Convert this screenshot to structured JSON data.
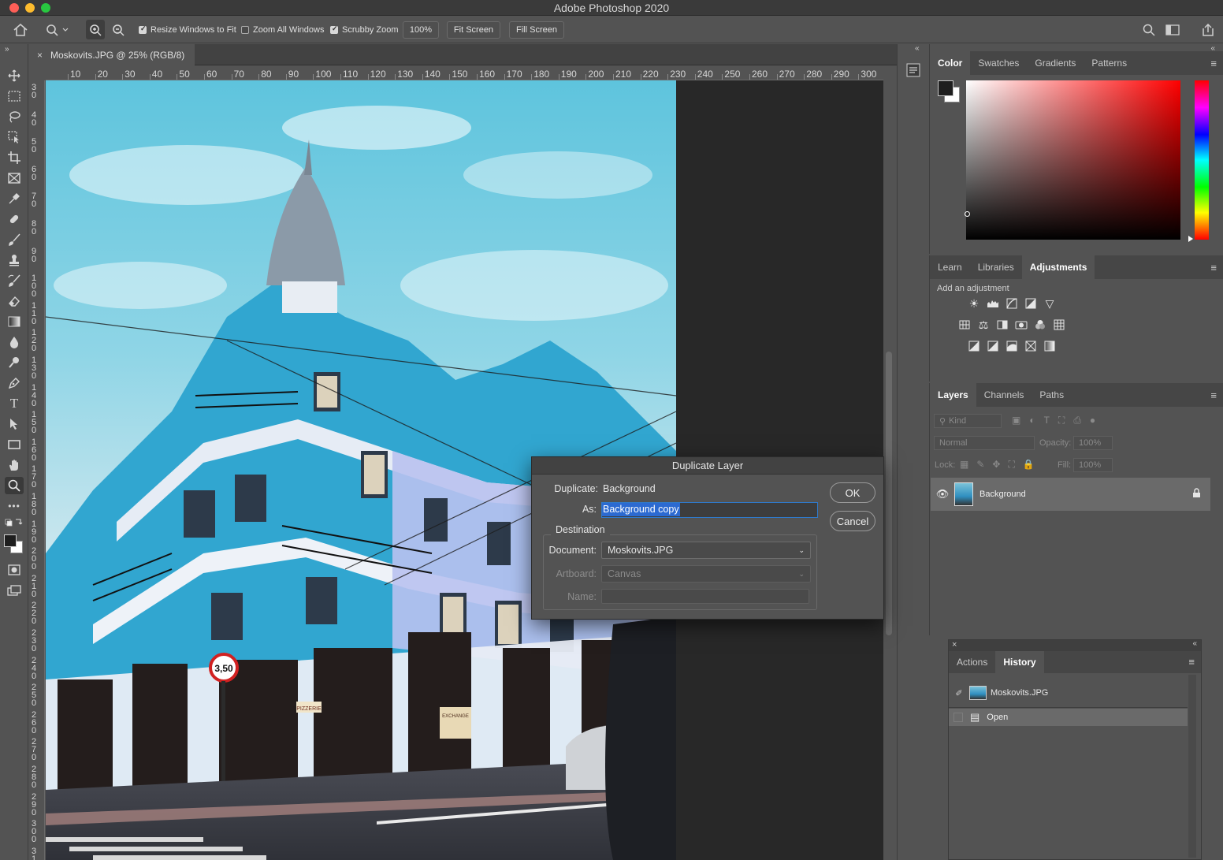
{
  "app": {
    "title": "Adobe Photoshop 2020"
  },
  "options": {
    "resize_windows": "Resize Windows to Fit",
    "zoom_all": "Zoom All Windows",
    "scrubby_zoom": "Scrubby Zoom",
    "zoom_value": "100%",
    "fit_screen": "Fit Screen",
    "fill_screen": "Fill Screen"
  },
  "document": {
    "tab_title": "Moskovits.JPG @ 25% (RGB/8)"
  },
  "ruler": {
    "top": [
      "10",
      "20",
      "30",
      "40",
      "50",
      "60",
      "70",
      "80",
      "90",
      "100",
      "110",
      "120",
      "130",
      "140",
      "150",
      "160",
      "170",
      "180",
      "190",
      "200",
      "210",
      "220",
      "230",
      "240",
      "250",
      "260",
      "270",
      "280",
      "290",
      "300"
    ],
    "left": [
      "3 0",
      "4 0",
      "5 0",
      "6 0",
      "7 0",
      "8 0",
      "9 0",
      "1 0 0",
      "1 1 0",
      "1 2 0",
      "1 3 0",
      "1 4 0",
      "1 5 0",
      "1 6 0",
      "1 7 0",
      "1 8 0",
      "1 9 0",
      "2 0 0",
      "2 1 0",
      "2 2 0",
      "2 3 0",
      "2 4 0",
      "2 5 0",
      "2 6 0",
      "2 7 0",
      "2 8 0",
      "2 9 0",
      "3 0 0",
      "3 1 0"
    ]
  },
  "color_panel": {
    "tabs": [
      "Color",
      "Swatches",
      "Gradients",
      "Patterns"
    ]
  },
  "adjust_panel": {
    "tabs": [
      "Learn",
      "Libraries",
      "Adjustments"
    ],
    "subtitle": "Add an adjustment"
  },
  "layers_panel": {
    "tabs": [
      "Layers",
      "Channels",
      "Paths"
    ],
    "kind": "Kind",
    "blend": "Normal",
    "opacity_label": "Opacity:",
    "opacity": "100%",
    "lock_label": "Lock:",
    "fill_label": "Fill:",
    "fill": "100%",
    "layer_name": "Background"
  },
  "history_panel": {
    "tabs": [
      "Actions",
      "History"
    ],
    "snapshot": "Moskovits.JPG",
    "state": "Open"
  },
  "dialog": {
    "title": "Duplicate Layer",
    "duplicate_label": "Duplicate:",
    "duplicate_value": "Background",
    "as_label": "As:",
    "as_value": "Background copy",
    "destination": "Destination",
    "document_label": "Document:",
    "document_value": "Moskovits.JPG",
    "artboard_label": "Artboard:",
    "artboard_value": "Canvas",
    "name_label": "Name:",
    "ok": "OK",
    "cancel": "Cancel"
  },
  "photo": {
    "signs": {
      "speed": "3,50",
      "shop1": "PIZZERIE",
      "shop2": "EXCHANGE"
    }
  },
  "colors": {
    "accent": "#2c6ad1",
    "panel": "#535353",
    "canvas_bg": "#282828"
  }
}
